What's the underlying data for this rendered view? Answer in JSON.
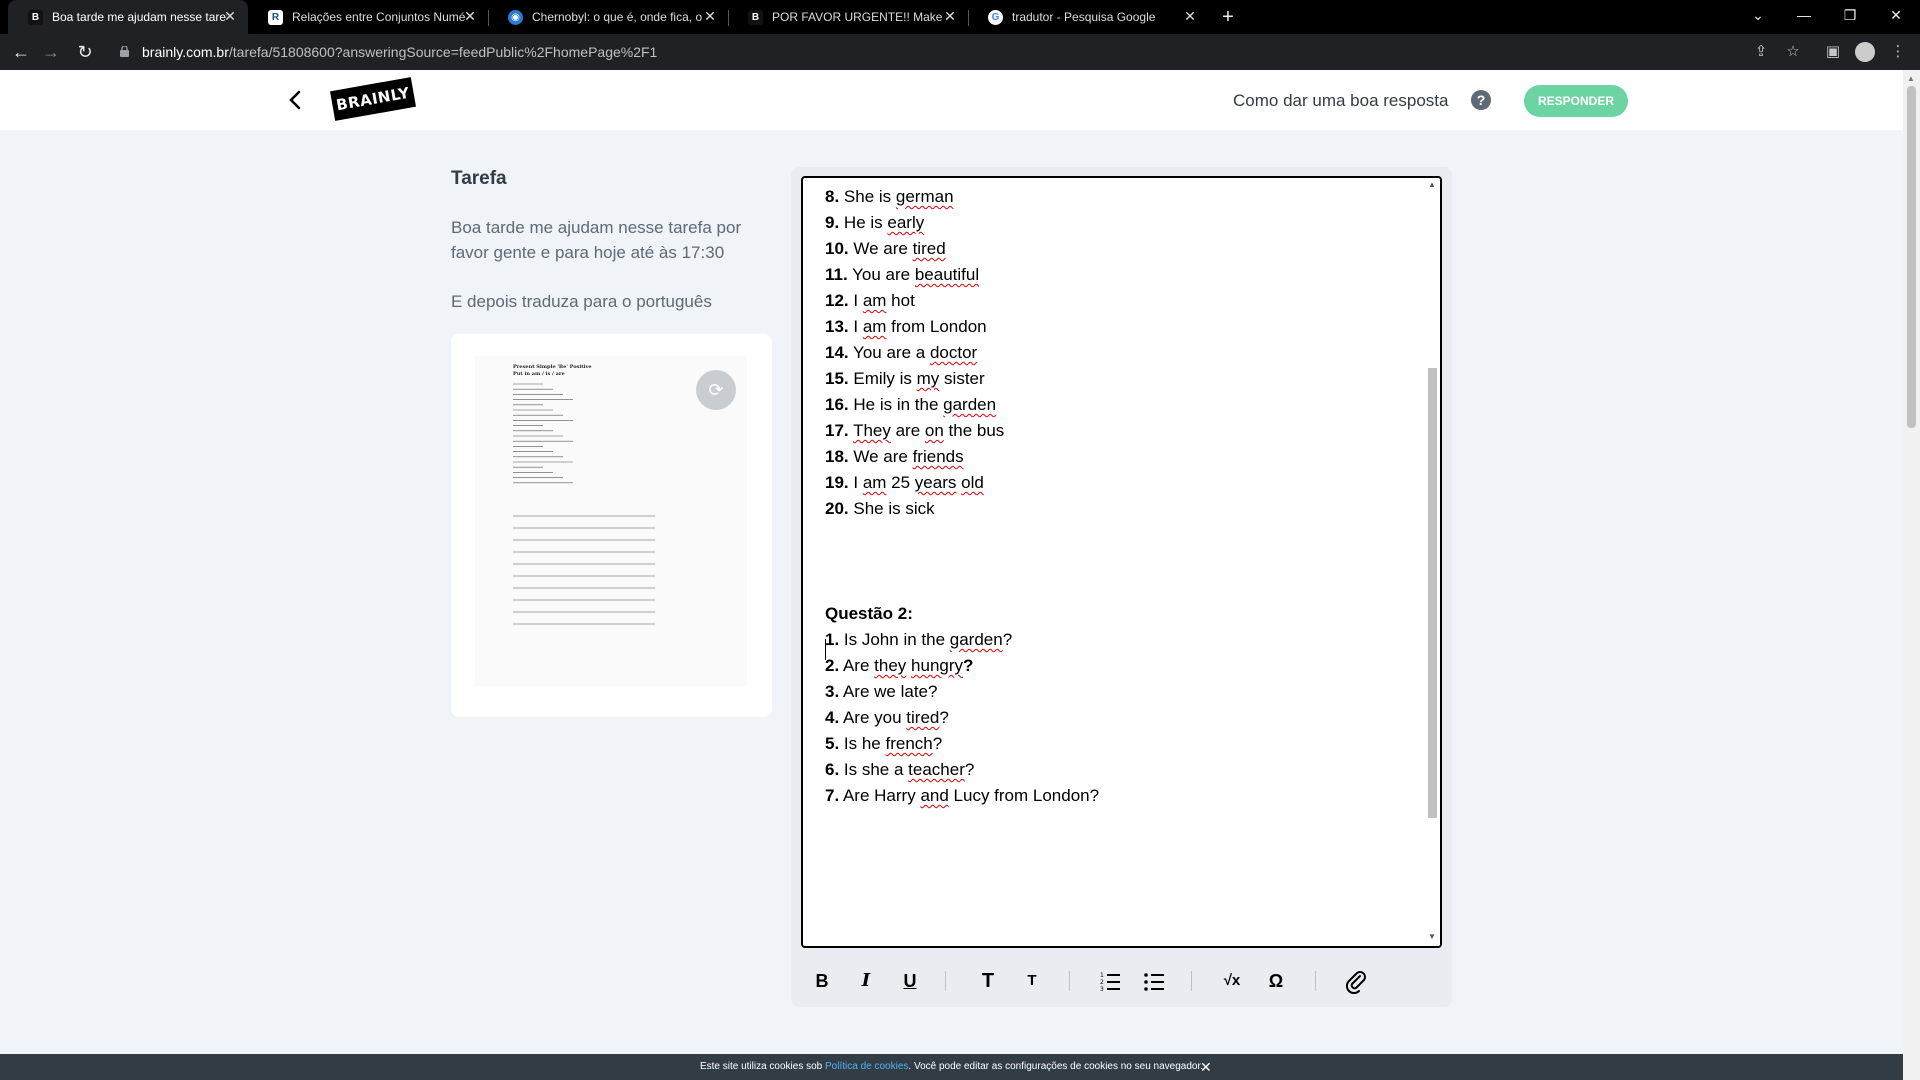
{
  "browser": {
    "tabs": [
      {
        "title": "Boa tarde me ajudam nesse taref",
        "favicon": "brainly-icon",
        "active": true
      },
      {
        "title": "Relações entre Conjuntos Numé",
        "favicon": "site-icon",
        "active": false
      },
      {
        "title": "Chernobyl: o que é, onde fica, o",
        "favicon": "globe-icon",
        "active": false
      },
      {
        "title": "POR FAVOR URGENTE!! Make a q",
        "favicon": "brainly-icon",
        "active": false
      },
      {
        "title": "tradutor - Pesquisa Google",
        "favicon": "google-icon",
        "active": false
      }
    ],
    "url_domain": "brainly.com.br",
    "url_path": "/tarefa/51808600?answeringSource=feedPublic%2FhomePage%2F1"
  },
  "header": {
    "logo": "BRAINLY",
    "help_link": "Como dar uma boa resposta",
    "help_icon": "?",
    "respond_button": "RESPONDER"
  },
  "question": {
    "title": "Tarefa",
    "text": "Boa tarde me ajudam nesse tarefa por favor gente e para hoje até às 17:30",
    "text2": "E depois traduza para o português",
    "attachment_title": "Present Simple 'Be' Positive",
    "attachment_subtitle": "Put in am / is / are"
  },
  "answer": {
    "lines": [
      {
        "num": "8.",
        "text": "She is german"
      },
      {
        "num": "9.",
        "text": "He is early"
      },
      {
        "num": "10.",
        "text": "We are tired"
      },
      {
        "num": "11.",
        "text": "You are beautiful"
      },
      {
        "num": "12.",
        "text": "I am hot"
      },
      {
        "num": "13.",
        "text": "I am from London"
      },
      {
        "num": "14.",
        "text": "You are a doctor"
      },
      {
        "num": "15.",
        "text": "Emily is my sister"
      },
      {
        "num": "16.",
        "text": "He is in the garden"
      },
      {
        "num": "17.",
        "text": "They are on the bus"
      },
      {
        "num": "18.",
        "text": "We are friends"
      },
      {
        "num": "19.",
        "text": "I am 25 years old"
      },
      {
        "num": "20.",
        "text": "She is sick"
      }
    ],
    "section2_title": "Questão 2:",
    "lines2": [
      {
        "num": "1.",
        "text": "Is John in the garden?"
      },
      {
        "num": "2.",
        "text": "Are they hungry?"
      },
      {
        "num": "3.",
        "text": "Are we late?"
      },
      {
        "num": "4.",
        "text": "Are you tired?"
      },
      {
        "num": "5.",
        "text": "Is he french?"
      },
      {
        "num": "6.",
        "text": "Is she a teacher?"
      },
      {
        "num": "7.",
        "text": "Are Harry and Lucy from London?"
      }
    ]
  },
  "toolbar": {
    "bold": "B",
    "italic": "I",
    "underline": "U",
    "heading_large": "T",
    "heading_small": "T",
    "math": "√x",
    "symbol": "Ω"
  },
  "cookie": {
    "prefix": "Este site utiliza cookies sob",
    "link": "Política de cookies",
    "suffix": ". Você pode editar as configurações de cookies no seu navegador.",
    "close": "✕"
  }
}
